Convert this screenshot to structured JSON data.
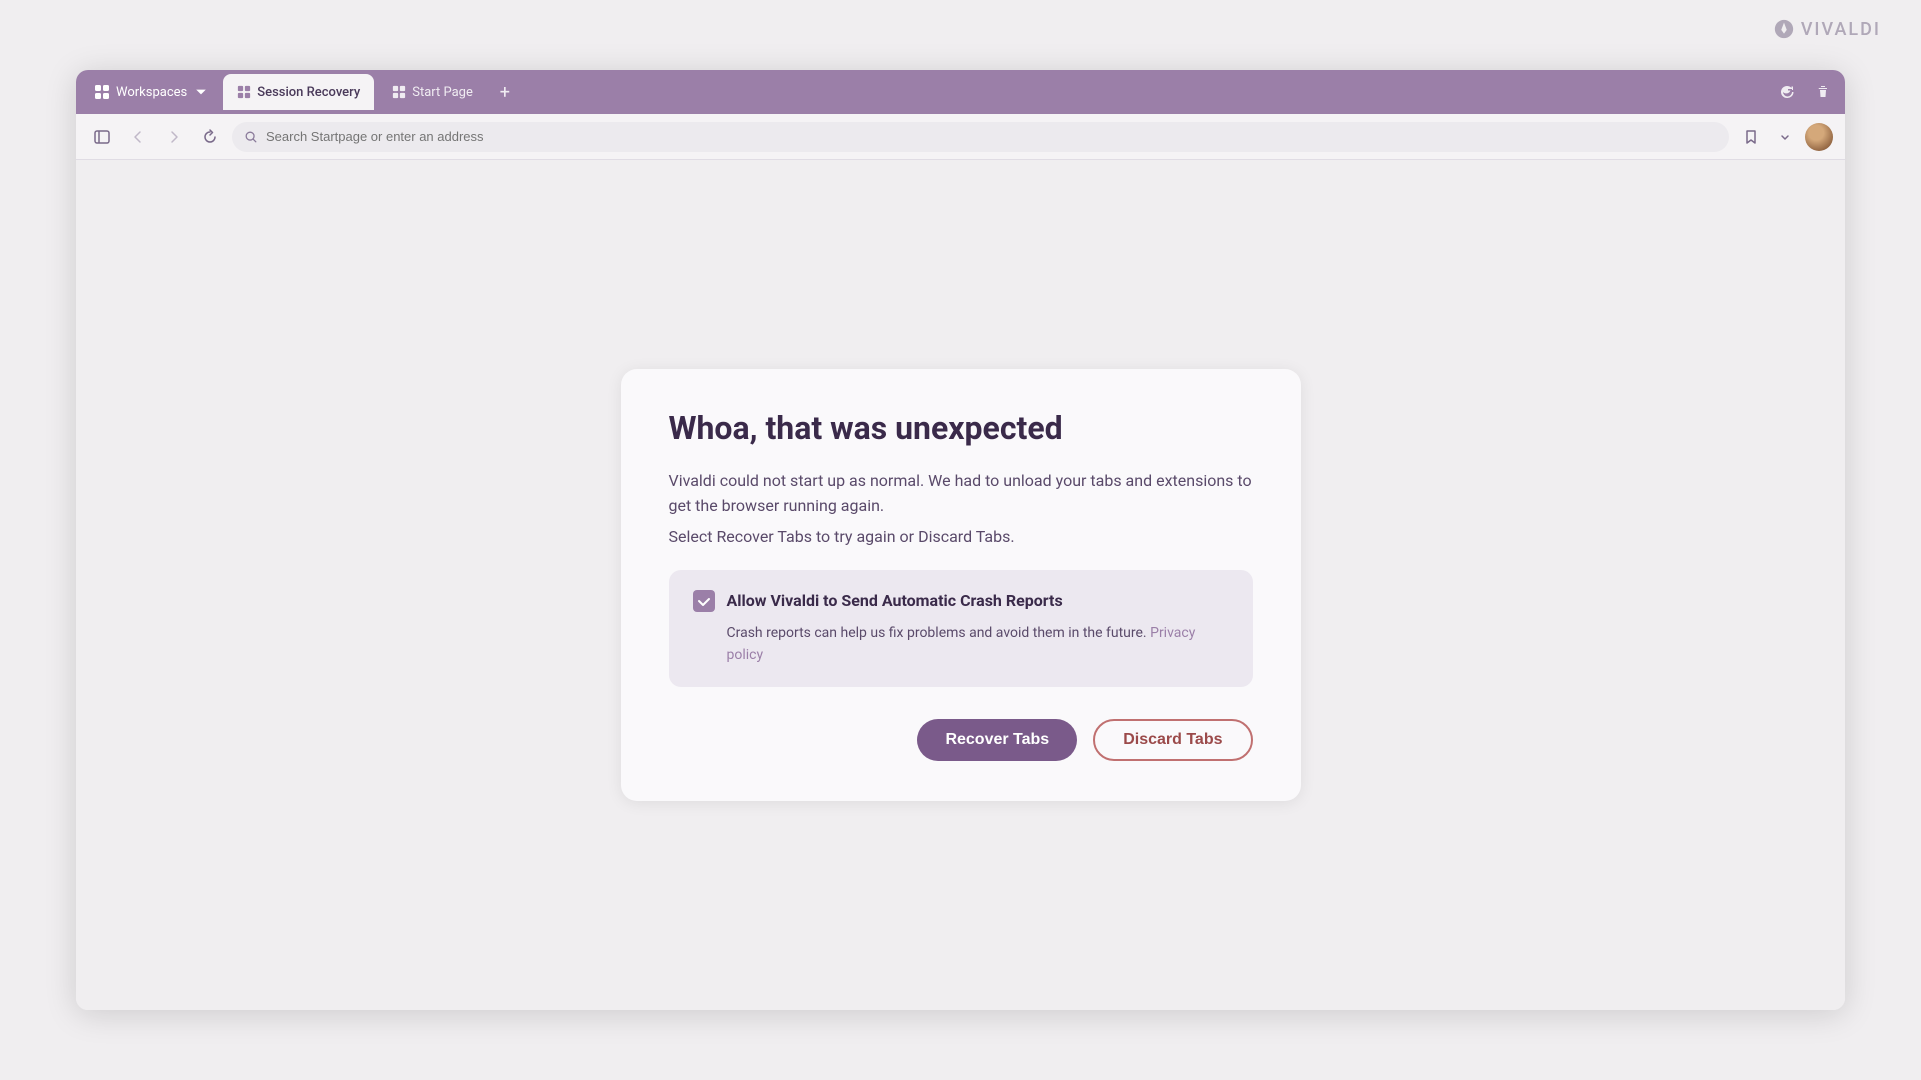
{
  "brand": {
    "name": "VIVALDI"
  },
  "tabbar": {
    "workspaces_label": "Workspaces",
    "session_recovery_label": "Session Recovery",
    "start_page_label": "Start Page"
  },
  "toolbar": {
    "search_placeholder": "Search Startpage or enter an address"
  },
  "recovery": {
    "title": "Whoa, that was unexpected",
    "description": "Vivaldi could not start up as normal. We had to unload your tabs and extensions to get the browser running again.",
    "action_text": "Select Recover Tabs to try again or Discard Tabs.",
    "crash_report": {
      "title": "Allow Vivaldi to Send Automatic Crash Reports",
      "description": "Crash reports can help us fix problems and avoid them in the future.",
      "privacy_link_text": "Privacy policy",
      "checked": true
    },
    "recover_button": "Recover Tabs",
    "discard_button": "Discard Tabs"
  }
}
